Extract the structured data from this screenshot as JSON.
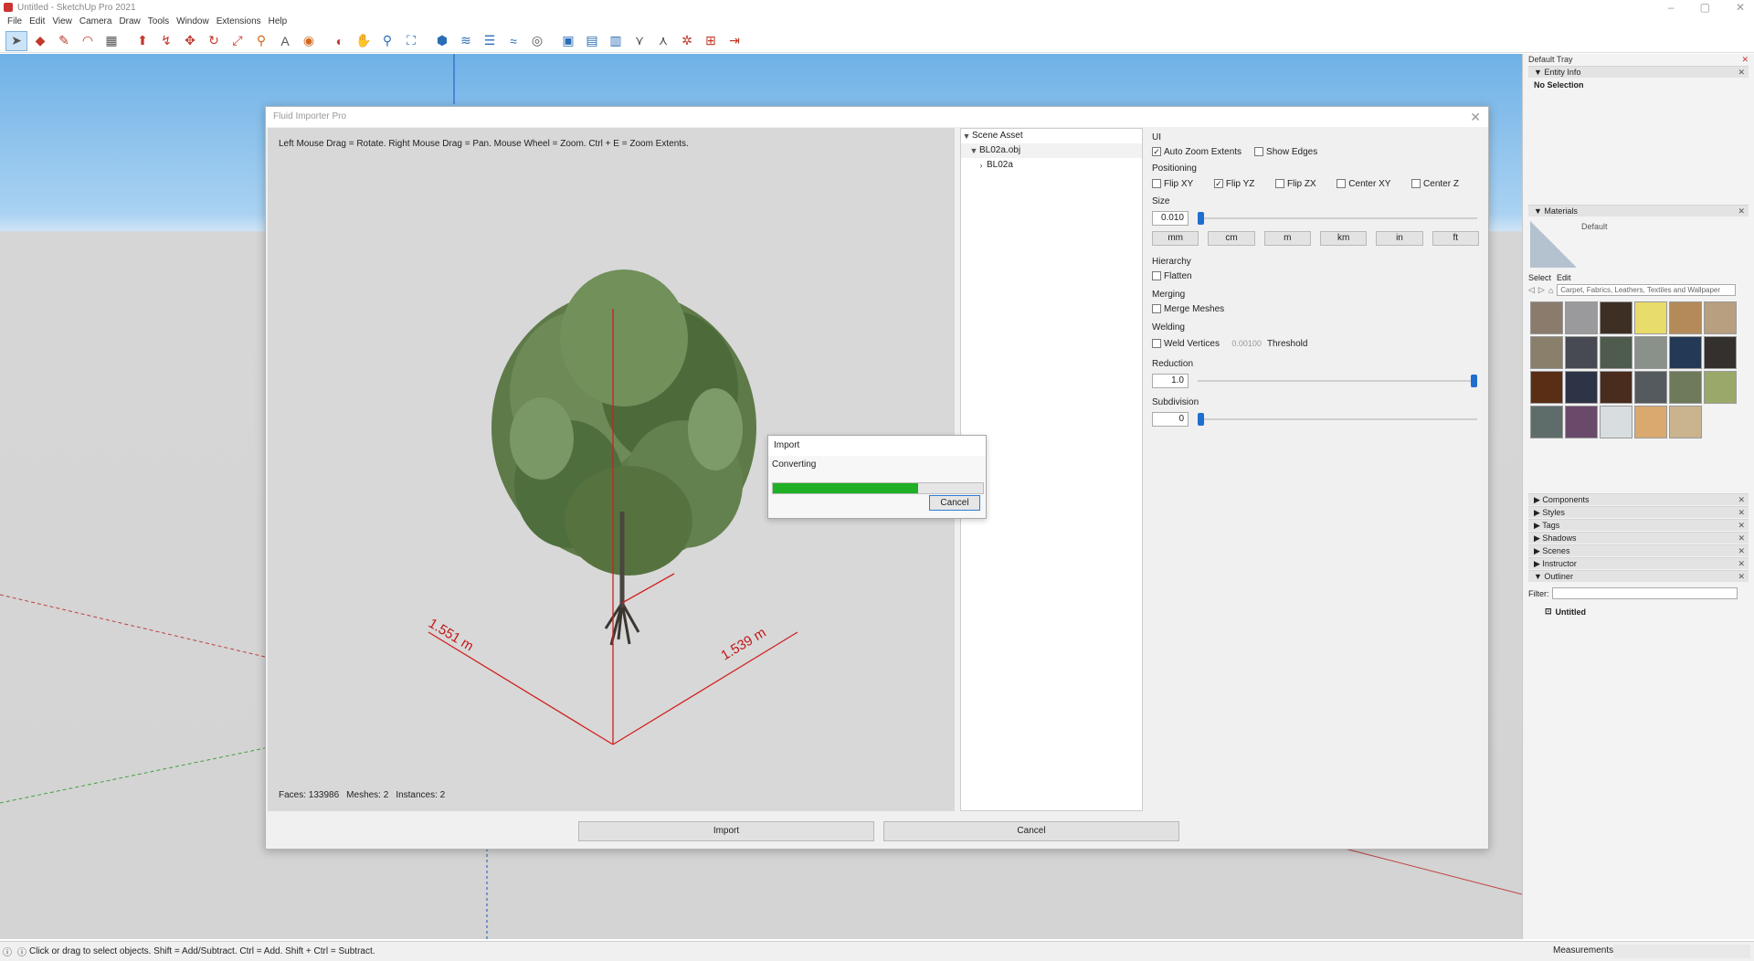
{
  "window": {
    "title": "Untitled - SketchUp Pro 2021"
  },
  "menu": [
    "File",
    "Edit",
    "View",
    "Camera",
    "Draw",
    "Tools",
    "Window",
    "Extensions",
    "Help"
  ],
  "dialog": {
    "title": "Fluid Importer Pro",
    "hint": "Left Mouse Drag = Rotate. Right Mouse Drag = Pan. Mouse Wheel = Zoom. Ctrl + E = Zoom Extents.",
    "dims": {
      "a": "1.551 m",
      "b": "1.539 m"
    },
    "stats": {
      "faces": "Faces: 133986",
      "meshes": "Meshes: 2",
      "instances": "Instances: 2"
    },
    "tree": {
      "root": "Scene Asset",
      "file": "BL02a.obj",
      "child": "BL02a"
    },
    "ui": {
      "label": "UI",
      "auto_zoom": "Auto Zoom Extents",
      "auto_zoom_checked": true,
      "show_edges": "Show Edges",
      "show_edges_checked": false
    },
    "positioning": {
      "label": "Positioning",
      "items": [
        {
          "label": "Flip XY",
          "checked": false
        },
        {
          "label": "Flip YZ",
          "checked": true
        },
        {
          "label": "Flip ZX",
          "checked": false
        },
        {
          "label": "Center XY",
          "checked": false
        },
        {
          "label": "Center Z",
          "checked": false
        }
      ]
    },
    "size": {
      "label": "Size",
      "value": "0.010",
      "slider": 0.0,
      "units": [
        "mm",
        "cm",
        "m",
        "km",
        "in",
        "ft"
      ]
    },
    "hierarchy": {
      "label": "Hierarchy",
      "flatten": "Flatten"
    },
    "merging": {
      "label": "Merging",
      "merge": "Merge Meshes"
    },
    "welding": {
      "label": "Welding",
      "weld": "Weld Vertices",
      "threshold_value": "0.00100",
      "threshold_label": "Threshold"
    },
    "reduction": {
      "label": "Reduction",
      "value": "1.0",
      "slider": 1.0
    },
    "subdivision": {
      "label": "Subdivision",
      "value": "0",
      "slider": 0.0
    },
    "import_btn": "Import",
    "cancel_btn": "Cancel"
  },
  "progress": {
    "title": "Import",
    "label": "Converting",
    "fraction": 0.69,
    "cancel": "Cancel"
  },
  "tray": {
    "title": "Default Tray",
    "entity_info": "Entity Info",
    "no_selection": "No Selection",
    "materials": "Materials",
    "mat_default": "Default",
    "tab_select": "Select",
    "tab_edit": "Edit",
    "collection": "Carpet, Fabrics, Leathers, Textiles and Wallpaper",
    "swatch_colors": [
      "#8a7b6d",
      "#9a9a9c",
      "#3e2f25",
      "#e8dc6a",
      "#b48a58",
      "#b79f7f",
      "#8a7f6a",
      "#474a52",
      "#4e5b4d",
      "#8a918a",
      "#243955",
      "#33302d",
      "#5a2e14",
      "#2d3446",
      "#4a2c1e",
      "#545a5e",
      "#6e7a5a",
      "#9aa96a",
      "#5e6d6a",
      "#6a4a6a",
      "#d8dde0",
      "#d9a970",
      "#c9b48e"
    ],
    "panels": [
      "Components",
      "Styles",
      "Tags",
      "Shadows",
      "Scenes",
      "Instructor",
      "Outliner"
    ],
    "filter": "Filter:",
    "outliner_item": "Untitled"
  },
  "status": {
    "message": "Click or drag to select objects. Shift = Add/Subtract. Ctrl = Add. Shift + Ctrl = Subtract.",
    "measurements": "Measurements"
  }
}
